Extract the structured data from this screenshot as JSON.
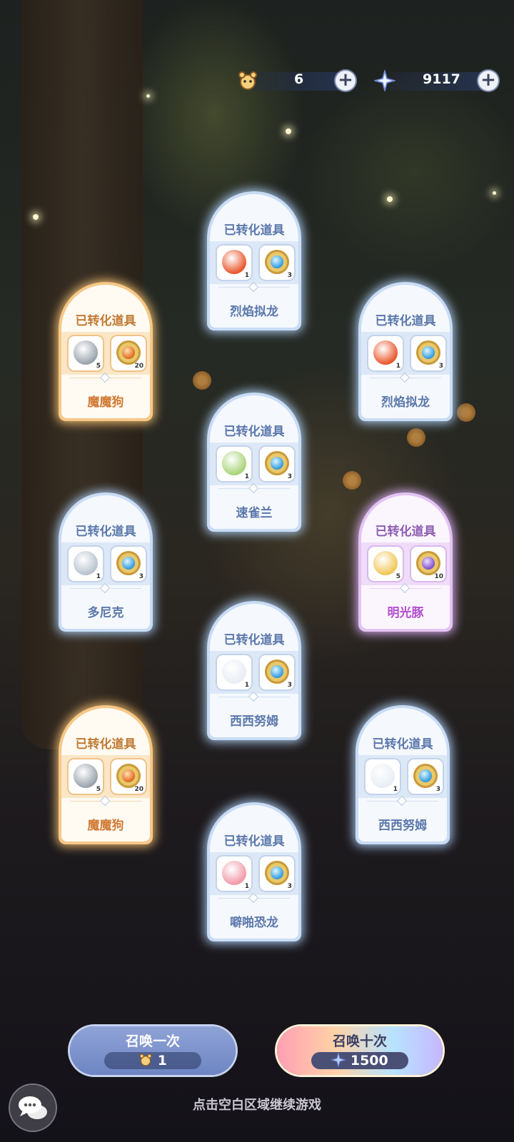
{
  "currency": {
    "tickets": {
      "icon": "hamster-ticket-icon",
      "value": "6",
      "add": "+"
    },
    "stars": {
      "icon": "crystal-star-icon",
      "value": "9117",
      "add": "+"
    }
  },
  "cards": [
    {
      "id": "c1",
      "rarity": "blue",
      "title": "已转化道具",
      "name": "烈焰拟龙",
      "items": [
        {
          "icon": "fire-dragon-icon",
          "count": "1"
        },
        {
          "icon": "blue-badge-icon",
          "count": "3"
        }
      ]
    },
    {
      "id": "c2",
      "rarity": "orange",
      "title": "已转化道具",
      "name": "魔魔狗",
      "items": [
        {
          "icon": "robot-dog-icon",
          "count": "5"
        },
        {
          "icon": "orange-badge-icon",
          "count": "20"
        }
      ]
    },
    {
      "id": "c3",
      "rarity": "blue",
      "title": "已转化道具",
      "name": "烈焰拟龙",
      "items": [
        {
          "icon": "fire-dragon-icon",
          "count": "1"
        },
        {
          "icon": "blue-badge-icon",
          "count": "3"
        }
      ]
    },
    {
      "id": "c4",
      "rarity": "blue",
      "title": "已转化道具",
      "name": "速雀兰",
      "items": [
        {
          "icon": "bird-sprite-icon",
          "count": "1"
        },
        {
          "icon": "blue-badge-icon",
          "count": "3"
        }
      ]
    },
    {
      "id": "c5",
      "rarity": "blue",
      "title": "已转化道具",
      "name": "多尼克",
      "items": [
        {
          "icon": "gray-sprite-icon",
          "count": "1"
        },
        {
          "icon": "blue-badge-icon",
          "count": "3"
        }
      ]
    },
    {
      "id": "c6",
      "rarity": "purple",
      "title": "已转化道具",
      "name": "明光豚",
      "items": [
        {
          "icon": "light-pig-icon",
          "count": "5"
        },
        {
          "icon": "purple-badge-icon",
          "count": "10"
        }
      ]
    },
    {
      "id": "c7",
      "rarity": "blue",
      "title": "已转化道具",
      "name": "西西努姆",
      "items": [
        {
          "icon": "white-sprite-icon",
          "count": "1"
        },
        {
          "icon": "blue-badge-icon",
          "count": "3"
        }
      ]
    },
    {
      "id": "c8",
      "rarity": "orange",
      "title": "已转化道具",
      "name": "魔魔狗",
      "items": [
        {
          "icon": "robot-dog-icon",
          "count": "5"
        },
        {
          "icon": "orange-badge-icon",
          "count": "20"
        }
      ]
    },
    {
      "id": "c9",
      "rarity": "blue",
      "title": "已转化道具",
      "name": "西西努姆",
      "items": [
        {
          "icon": "white-sprite-icon",
          "count": "1"
        },
        {
          "icon": "blue-badge-icon",
          "count": "3"
        }
      ]
    },
    {
      "id": "c10",
      "rarity": "blue",
      "title": "已转化道具",
      "name": "噼啪恐龙",
      "items": [
        {
          "icon": "pink-dino-icon",
          "count": "1"
        },
        {
          "icon": "blue-badge-icon",
          "count": "3"
        }
      ]
    }
  ],
  "buttons": {
    "summon_one": {
      "label": "召唤一次",
      "cost": "1",
      "cost_icon": "hamster-ticket-icon"
    },
    "summon_ten": {
      "label": "召唤十次",
      "cost": "1500",
      "cost_icon": "crystal-star-icon"
    }
  },
  "hint": "点击空白区域继续游戏",
  "chat": {
    "icon": "chat-bubble-icon"
  }
}
